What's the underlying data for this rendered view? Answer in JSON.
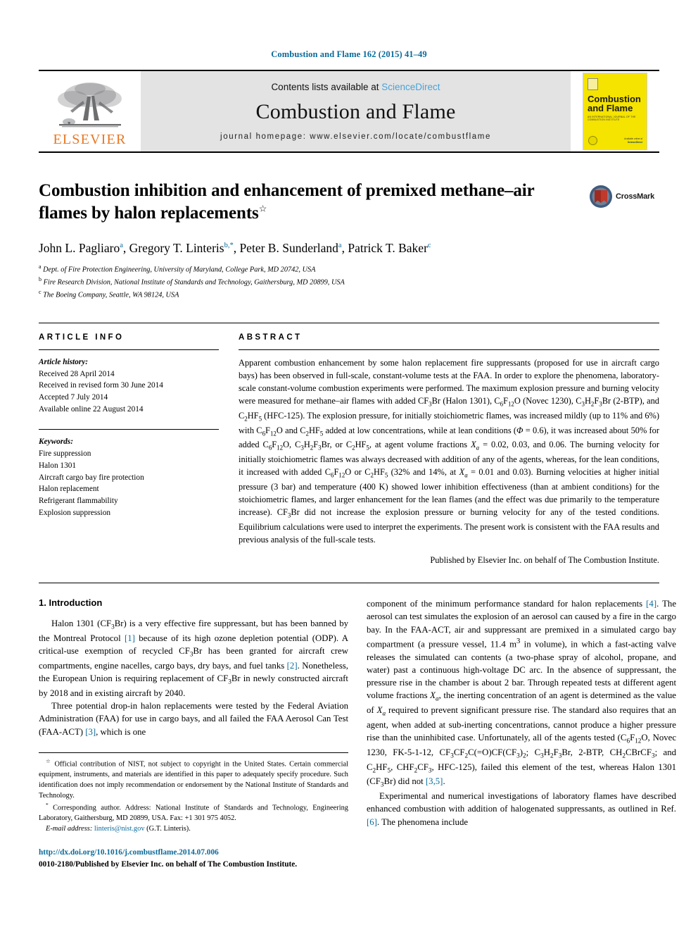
{
  "running_head": "Combustion and Flame 162 (2015) 41–49",
  "masthead": {
    "publisher_word": "ELSEVIER",
    "contents_prefix": "Contents lists available at ",
    "contents_link": "ScienceDirect",
    "journal_name": "Combustion and Flame",
    "homepage": "journal homepage: www.elsevier.com/locate/combustflame",
    "cover": {
      "title_line1": "Combustion",
      "title_line2": "and Flame",
      "subtitle": "AN INTERNATIONAL JOURNAL OF THE COMBUSTION INSTITUTE",
      "footer_line1": "Available online at",
      "footer_line2": "ScienceDirect"
    }
  },
  "article": {
    "title_line1": "Combustion inhibition and enhancement of premixed methane–air",
    "title_line2": "flames by halon replacements",
    "title_footnote_marker": "☆",
    "crossmark_label": "CrossMark",
    "authors": [
      {
        "name": "John L. Pagliaro",
        "marks": "a"
      },
      {
        "name": "Gregory T. Linteris",
        "marks": "b,*"
      },
      {
        "name": "Peter B. Sunderland",
        "marks": "a"
      },
      {
        "name": "Patrick T. Baker",
        "marks": "c"
      }
    ],
    "affiliations": [
      {
        "mark": "a",
        "text": "Dept. of Fire Protection Engineering, University of Maryland, College Park, MD 20742, USA"
      },
      {
        "mark": "b",
        "text": "Fire Research Division, National Institute of Standards and Technology, Gaithersburg, MD 20899, USA"
      },
      {
        "mark": "c",
        "text": "The Boeing Company, Seattle, WA 98124, USA"
      }
    ]
  },
  "article_info": {
    "heading": "ARTICLE INFO",
    "history_label": "Article history:",
    "history": [
      "Received 28 April 2014",
      "Received in revised form 30 June 2014",
      "Accepted 7 July 2014",
      "Available online 22 August 2014"
    ],
    "keywords_label": "Keywords:",
    "keywords": [
      "Fire suppression",
      "Halon 1301",
      "Aircraft cargo bay fire protection",
      "Halon replacement",
      "Refrigerant flammability",
      "Explosion suppression"
    ]
  },
  "abstract": {
    "heading": "ABSTRACT",
    "publisher_note": "Published by Elsevier Inc. on behalf of The Combustion Institute."
  },
  "introduction": {
    "heading": "1. Introduction"
  },
  "footnotes": {
    "star_note": "Official contribution of NIST, not subject to copyright in the United States. Certain commercial equipment, instruments, and materials are identified in this paper to adequately specify procedure. Such identification does not imply recommendation or endorsement by the National Institute of Standards and Technology.",
    "corresponding": "Corresponding author. Address: National Institute of Standards and Technology, Engineering Laboratory, Gaithersburg, MD 20899, USA. Fax: +1 301 975 4052.",
    "email_label": "E-mail address:",
    "email": "linteris@nist.gov",
    "email_owner": "(G.T. Linteris)."
  },
  "imprint": {
    "doi_url": "http://dx.doi.org/10.1016/j.combustflame.2014.07.006",
    "issn_line": "0010-2180/Published by Elsevier Inc. on behalf of The Combustion Institute."
  },
  "colors": {
    "link": "#0a6a9a",
    "elsevier_orange": "#E87722",
    "cover_yellow": "#f5e300",
    "masthead_grey": "#e3e3e3"
  }
}
